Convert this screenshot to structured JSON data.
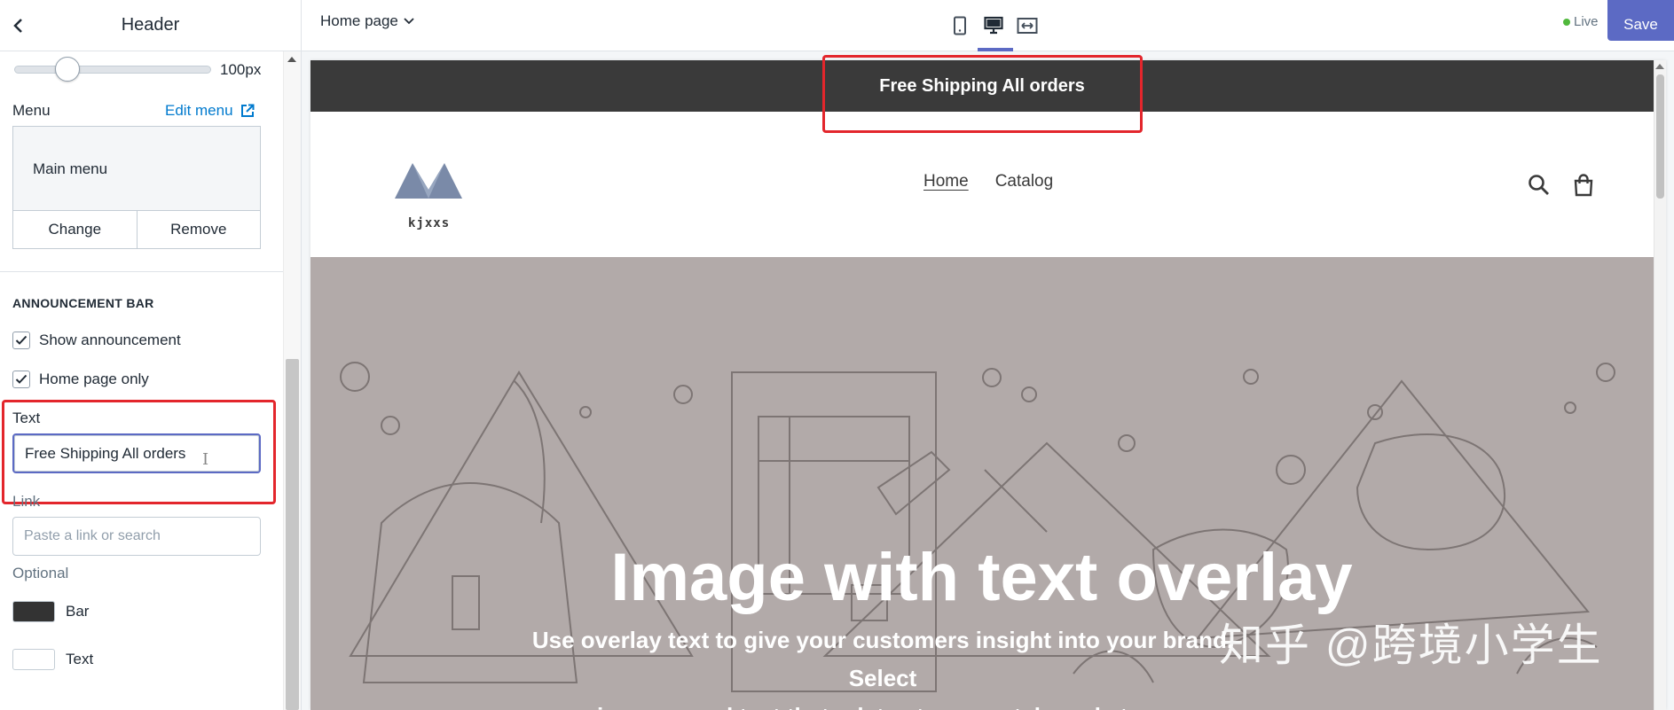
{
  "sidebar": {
    "title": "Header",
    "slider_value": "100px",
    "menu_label": "Menu",
    "edit_menu": "Edit menu",
    "menu_name": "Main menu",
    "change_label": "Change",
    "remove_label": "Remove",
    "section_title": "ANNOUNCEMENT BAR",
    "show_announcement": "Show announcement",
    "home_page_only": "Home page only",
    "text_label": "Text",
    "text_value": "Free Shipping All orders",
    "link_label": "Link",
    "link_placeholder": "Paste a link or search",
    "optional_label": "Optional",
    "bar_label": "Bar",
    "text_color_label": "Text",
    "colors": {
      "bar": "#333333",
      "text": "#ffffff"
    }
  },
  "topbar": {
    "page_select": "Home page",
    "live_label": "Live",
    "save_label": "Save",
    "active_device": "desktop"
  },
  "preview": {
    "announcement": "Free Shipping All orders",
    "logo_text": "kjxxs",
    "nav": [
      "Home",
      "Catalog"
    ],
    "hero_title": "Image with text overlay",
    "hero_subtitle_line1": "Use overlay text to give your customers insight into your brand. Select",
    "hero_subtitle_line2": "imagery and text that relates to your style and story."
  },
  "watermark": "知乎 @跨境小学生",
  "colors": {
    "accent": "#5c6ac4",
    "announcement_bg": "#3a3a3a",
    "highlight": "#e3262c",
    "hero_bg": "#b2aaa9"
  }
}
